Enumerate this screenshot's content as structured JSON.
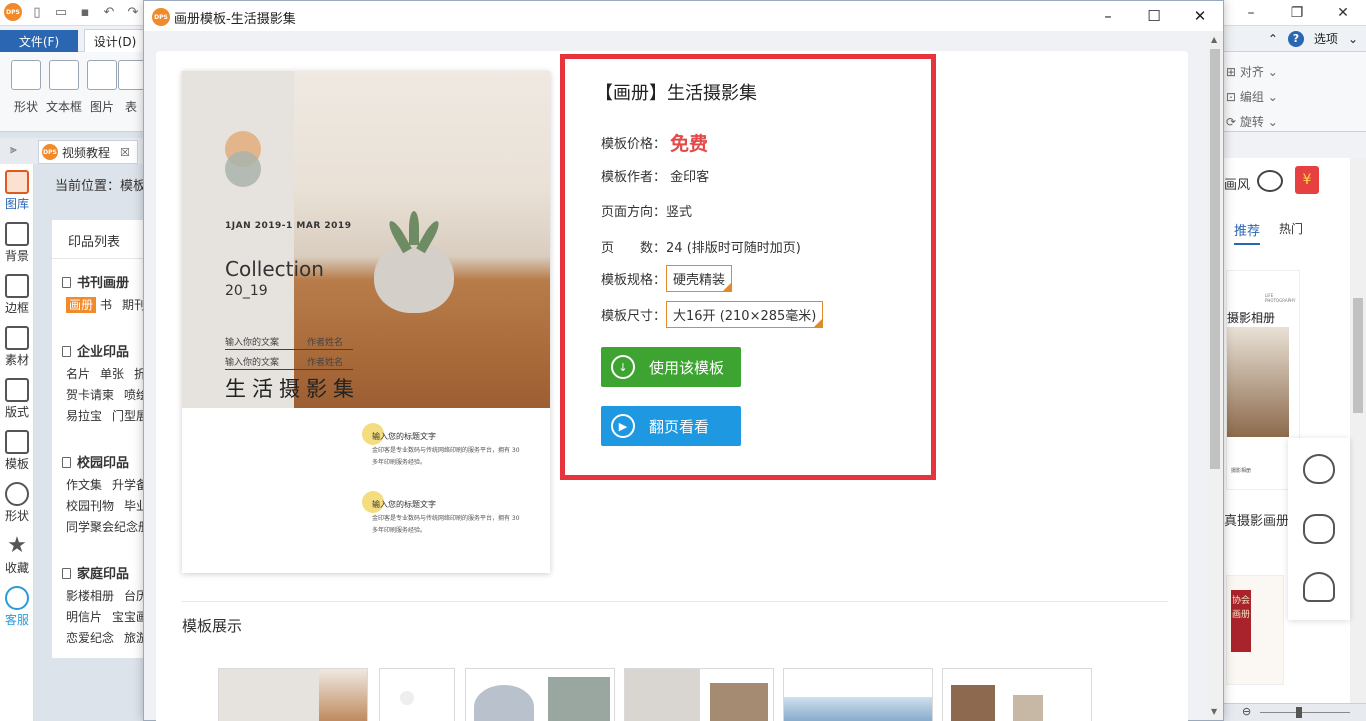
{
  "app": {
    "file_tab": "文件(F)",
    "design_tab": "设计(D)",
    "options": "选项",
    "help": "?",
    "tools": [
      "形状",
      "文本框",
      "图片",
      "表"
    ],
    "align_tools": [
      "对齐",
      "编组",
      "旋转"
    ],
    "doc_tab": "视频教程",
    "breadcrumb": "当前位置：模板",
    "rail": [
      "图库",
      "背景",
      "边框",
      "素材",
      "版式",
      "模板",
      "形状",
      "收藏",
      "客服"
    ],
    "panel": {
      "title": "印品列表",
      "sections": [
        {
          "name": "书刊画册",
          "links": [
            "画册",
            "书",
            "期刊"
          ]
        },
        {
          "name": "企业印品",
          "links": [
            "名片",
            "单张",
            "折页",
            "贺卡请柬",
            "喷绘",
            "易拉宝",
            "门型展架"
          ]
        },
        {
          "name": "校园印品",
          "links": [
            "作文集",
            "升学备考",
            "校园刊物",
            "毕业纪念",
            "同学聚会纪念册"
          ]
        },
        {
          "name": "家庭印品",
          "links": [
            "影楼相册",
            "台历",
            "明信片",
            "宝宝画册",
            "恋爱纪念",
            "旅游"
          ]
        }
      ]
    },
    "right_panel": {
      "wind": "画风",
      "tab_recommend": "推荐",
      "tab_hot": "热门",
      "item1": "摄影相册",
      "item2": "真摄影画册",
      "stamp": "协会画册",
      "thumb_tag1": "LIFE PHOTOGRAPHY",
      "thumb_tag2": "摄影相册"
    }
  },
  "dialog": {
    "title": "画册模板-生活摄影集",
    "cover": {
      "date": "1JAN 2019-1 MAR 2019",
      "collection": "Collection",
      "year": "20_19",
      "line1_left": "输入你的文案",
      "line1_right": "作者姓名",
      "line2_left": "输入你的文案",
      "line2_right": "作者姓名",
      "main_title": "生活摄影集",
      "sub1": "输入您的标题文字",
      "para1": "金印客是专业数码与传统网络印刷的服务平台，拥有 30 多年印刷服务经验。",
      "sub2": "输入您的标题文字",
      "para2": "金印客是专业数码与传统网络印刷的服务平台，拥有 30 多年印刷服务经验。"
    },
    "info": {
      "title": "【画册】生活摄影集",
      "price_label": "模板价格：",
      "price": "免费",
      "author_label": "模板作者：",
      "author": "金印客",
      "orient_label": "页面方向：",
      "orient": "竖式",
      "pages_label": "页　　数：",
      "pages": "24 (排版时可随时加页)",
      "spec_label": "模板规格：",
      "spec": "硬壳精装",
      "size_label": "模板尺寸：",
      "size": "大16开 (210×285毫米)",
      "use_button": "使用该模板",
      "flip_button": "翻页看看"
    },
    "showcase_title": "模板展示"
  }
}
